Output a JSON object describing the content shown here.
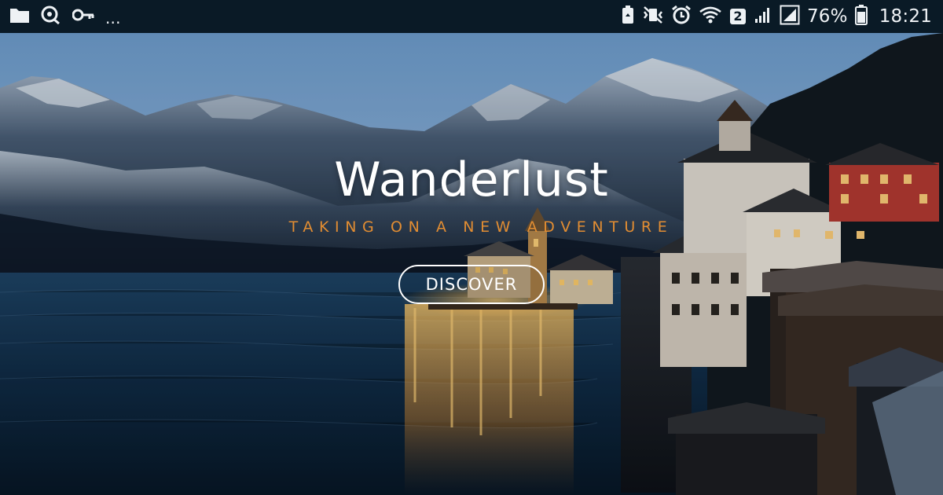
{
  "status_bar": {
    "left_icons": [
      "folder-icon",
      "sync-icon",
      "key-icon"
    ],
    "overflow_text": "...",
    "right_icons": [
      "recycle-icon",
      "vibrate-mute-icon",
      "alarm-icon",
      "wifi-icon",
      "sim-2-icon",
      "signal-icon",
      "signal-box-icon",
      "battery-icon"
    ],
    "sim_badge": "2",
    "battery": "76%",
    "time": "18:21"
  },
  "hero": {
    "title": "Wanderlust",
    "subtitle": "TAKING ON A NEW ADVENTURE",
    "cta_label": "DISCOVER"
  },
  "colors": {
    "status_bar_bg": "#0a1a26",
    "subtitle_accent": "#e28d32",
    "title_text": "#ffffff"
  }
}
